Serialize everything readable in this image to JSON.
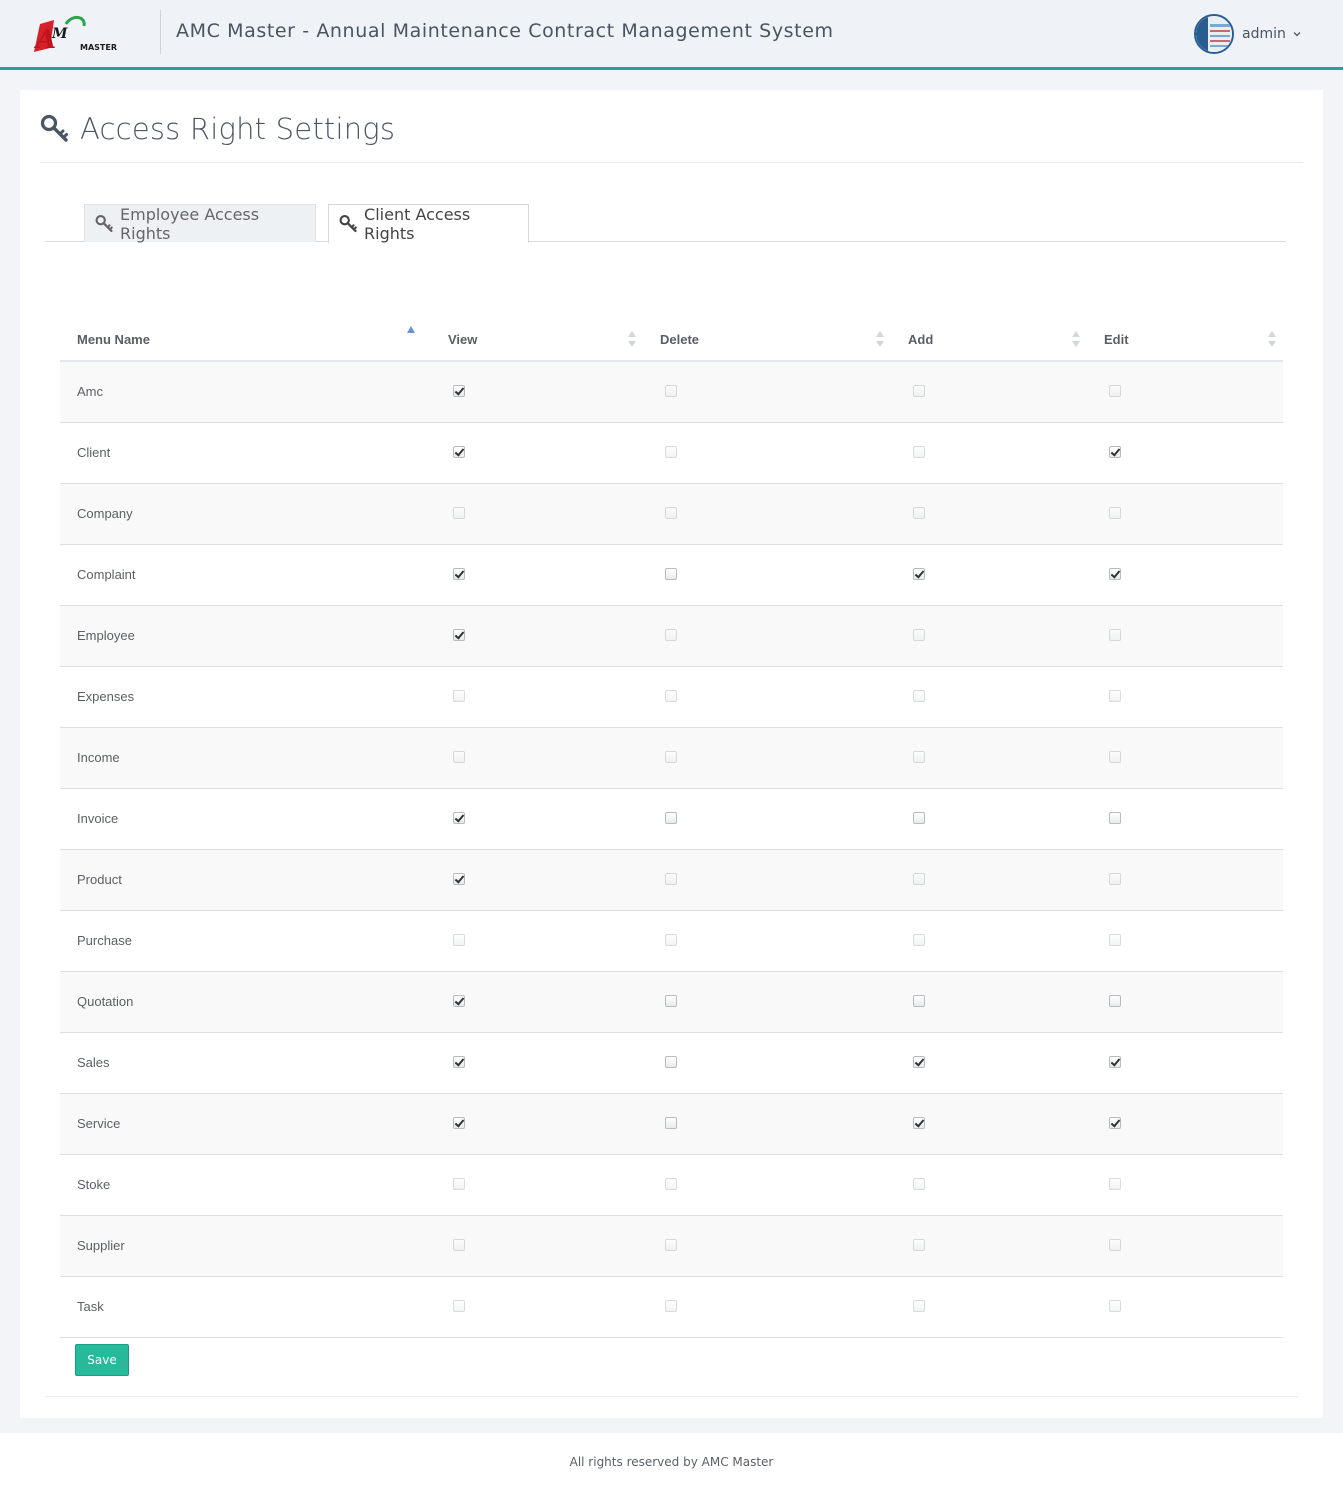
{
  "header": {
    "logo_text": "AMC MASTER",
    "app_title": "AMC Master - Annual Maintenance Contract Management System",
    "username": "admin"
  },
  "page": {
    "title": "Access Right Settings"
  },
  "tabs": [
    {
      "label": "Employee Access Rights",
      "active": false
    },
    {
      "label": "Client Access Rights",
      "active": true
    }
  ],
  "table": {
    "columns": [
      "Menu Name",
      "View",
      "Delete",
      "Add",
      "Edit"
    ],
    "sort": {
      "column": "Menu Name",
      "direction": "asc"
    },
    "rows": [
      {
        "name": "Amc",
        "view": true,
        "delete": false,
        "add": false,
        "edit": false,
        "enabled": [
          true,
          false,
          false,
          false
        ]
      },
      {
        "name": "Client",
        "view": true,
        "delete": false,
        "add": false,
        "edit": true,
        "enabled": [
          true,
          false,
          false,
          true
        ]
      },
      {
        "name": "Company",
        "view": false,
        "delete": false,
        "add": false,
        "edit": false,
        "enabled": [
          false,
          false,
          false,
          false
        ]
      },
      {
        "name": "Complaint",
        "view": true,
        "delete": false,
        "add": true,
        "edit": true,
        "enabled": [
          true,
          true,
          true,
          true
        ]
      },
      {
        "name": "Employee",
        "view": true,
        "delete": false,
        "add": false,
        "edit": false,
        "enabled": [
          true,
          false,
          false,
          false
        ]
      },
      {
        "name": "Expenses",
        "view": false,
        "delete": false,
        "add": false,
        "edit": false,
        "enabled": [
          false,
          false,
          false,
          false
        ]
      },
      {
        "name": "Income",
        "view": false,
        "delete": false,
        "add": false,
        "edit": false,
        "enabled": [
          false,
          false,
          false,
          false
        ]
      },
      {
        "name": "Invoice",
        "view": true,
        "delete": false,
        "add": false,
        "edit": false,
        "enabled": [
          true,
          true,
          true,
          true
        ]
      },
      {
        "name": "Product",
        "view": true,
        "delete": false,
        "add": false,
        "edit": false,
        "enabled": [
          true,
          false,
          false,
          false
        ]
      },
      {
        "name": "Purchase",
        "view": false,
        "delete": false,
        "add": false,
        "edit": false,
        "enabled": [
          false,
          false,
          false,
          false
        ]
      },
      {
        "name": "Quotation",
        "view": true,
        "delete": false,
        "add": false,
        "edit": false,
        "enabled": [
          true,
          true,
          true,
          true
        ]
      },
      {
        "name": "Sales",
        "view": true,
        "delete": false,
        "add": true,
        "edit": true,
        "enabled": [
          true,
          true,
          true,
          true
        ]
      },
      {
        "name": "Service",
        "view": true,
        "delete": false,
        "add": true,
        "edit": true,
        "enabled": [
          true,
          true,
          true,
          true
        ]
      },
      {
        "name": "Stoke",
        "view": false,
        "delete": false,
        "add": false,
        "edit": false,
        "enabled": [
          false,
          false,
          false,
          false
        ]
      },
      {
        "name": "Supplier",
        "view": false,
        "delete": false,
        "add": false,
        "edit": false,
        "enabled": [
          false,
          false,
          false,
          false
        ]
      },
      {
        "name": "Task",
        "view": false,
        "delete": false,
        "add": false,
        "edit": false,
        "enabled": [
          false,
          false,
          false,
          false
        ]
      }
    ]
  },
  "actions": {
    "save_label": "Save"
  },
  "footer": {
    "text": "All rights reserved by AMC Master"
  },
  "colors": {
    "accent": "#1fa39a",
    "save_button": "#26b99a"
  },
  "icons": {
    "page": "key-icon",
    "tab": "key-icon",
    "user_menu": "chevron-down-icon",
    "sort": "sort-icon"
  }
}
